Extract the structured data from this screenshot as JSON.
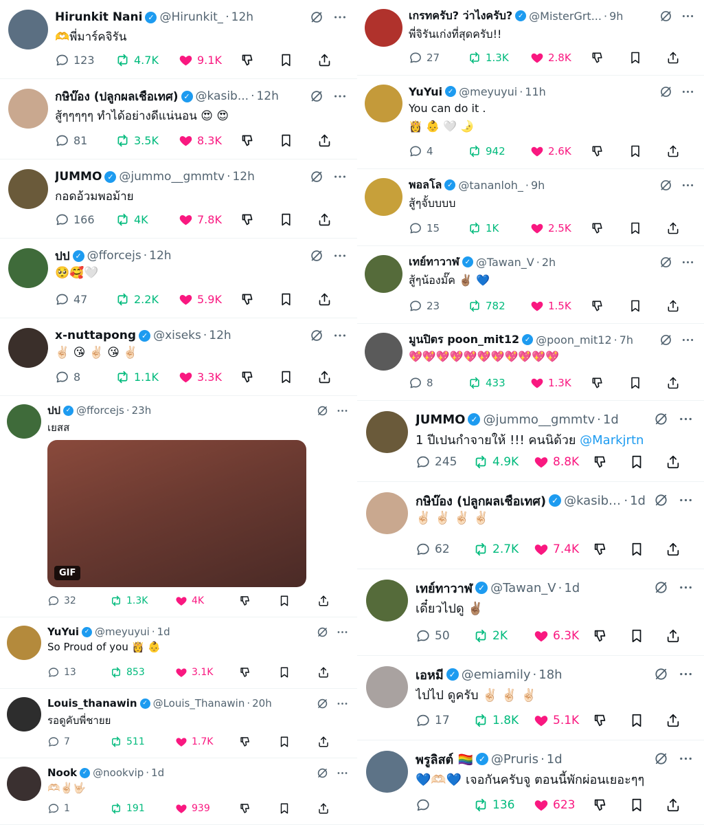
{
  "colors": {
    "accent": "#1d9bf0",
    "retweet": "#00ba7c",
    "like": "#f91880",
    "muted": "#536471"
  },
  "left_tweets": [
    {
      "name": "Hirunkit Nani",
      "handle": "@Hirunkit_",
      "time": "12h",
      "text": "🫶พี่มาร์คจิรัน",
      "replies": "123",
      "reposts": "4.7K",
      "likes": "9.1K"
    },
    {
      "name": "กษิบ๊อง (ปลูกผลเชือเทศ)",
      "handle": "@kasib...",
      "time": "12h",
      "text": "สู้ๆๆๆๆๆ ทำได้อย่างดีแน่นอน 😍 😍",
      "replies": "81",
      "reposts": "3.5K",
      "likes": "8.3K"
    },
    {
      "name": "JUMMO",
      "handle": "@jummo__gmmtv",
      "time": "12h",
      "text": "กอดอ้วมพอม้าย",
      "replies": "166",
      "reposts": "4K",
      "likes": "7.8K"
    },
    {
      "name": "ปป",
      "handle": "@fforcejs",
      "time": "12h",
      "text": "🥺🥰🤍",
      "replies": "47",
      "reposts": "2.2K",
      "likes": "5.9K"
    },
    {
      "name": "x-nuttapong",
      "handle": "@xiseks",
      "time": "12h",
      "text": "✌🏻 😘 ✌🏻 😘 ✌🏻",
      "replies": "8",
      "reposts": "1.1K",
      "likes": "3.3K"
    },
    {
      "name": "ปป",
      "handle": "@fforcejs",
      "time": "23h",
      "text": "เยสส",
      "gif_label": "GIF",
      "replies": "32",
      "reposts": "1.3K",
      "likes": "4K"
    },
    {
      "name": "YuYui",
      "handle": "@meyuyui",
      "time": "1d",
      "text": "So Proud of you 👸 👶",
      "replies": "13",
      "reposts": "853",
      "likes": "3.1K"
    },
    {
      "name": "Louis_thanawin",
      "handle": "@Louis_Thanawin",
      "time": "20h",
      "text": "รอดูคับพี่ชายย",
      "replies": "7",
      "reposts": "511",
      "likes": "1.7K"
    },
    {
      "name": "Nook",
      "handle": "@nookvip",
      "time": "1d",
      "text": "🫶🏻✌🏻🤟🏻",
      "replies": "1",
      "reposts": "191",
      "likes": "939"
    }
  ],
  "right_tweets": [
    {
      "name": "เกรทครับ? ว่าไงครับ?",
      "handle": "@MisterGrt...",
      "time": "9h",
      "text": "พี่จิรันเก่งที่สุดครับ!!",
      "replies": "27",
      "reposts": "1.3K",
      "likes": "2.8K"
    },
    {
      "name": "YuYui",
      "handle": "@meyuyui",
      "time": "11h",
      "text": "You can do it .",
      "text2": "👸 👶 🤍 🌛",
      "replies": "4",
      "reposts": "942",
      "likes": "2.6K"
    },
    {
      "name": "พอลโล",
      "handle": "@tananloh_",
      "time": "9h",
      "text": "สู้ๆจั้บบบบ",
      "replies": "15",
      "reposts": "1K",
      "likes": "2.5K"
    },
    {
      "name": "เทย์ทาวาฬ",
      "handle": "@Tawan_V",
      "time": "2h",
      "text": "สู้ๆน้องมั๊ค ✌🏽 💙",
      "replies": "23",
      "reposts": "782",
      "likes": "1.5K"
    },
    {
      "name": "มูนปิตร poon_mit12",
      "handle": "@poon_mit12",
      "time": "7h",
      "text": "💖💖💖💖💖💖💖💖💖💖💖",
      "replies": "8",
      "reposts": "433",
      "likes": "1.3K"
    },
    {
      "name": "JUMMO",
      "handle": "@jummo__gmmtv",
      "time": "1d",
      "text": "1 ปีเปนกำจายให้ !!! คนนิด้วย ",
      "mention": "@Markjrtn",
      "replies": "245",
      "reposts": "4.9K",
      "likes": "8.8K"
    },
    {
      "name": "กษิบ๊อง (ปลูกผลเชือเทศ)",
      "handle": "@kasibook",
      "time": "1d",
      "text": "✌🏻 ✌🏻 ✌🏻 ✌🏻",
      "replies": "62",
      "reposts": "2.7K",
      "likes": "7.4K"
    },
    {
      "name": "เทย์ทาวาฬ",
      "handle": "@Tawan_V",
      "time": "1d",
      "text": "เดี๋ยวไปดู ✌🏽",
      "replies": "50",
      "reposts": "2K",
      "likes": "6.3K"
    },
    {
      "name": "เอหมี",
      "handle": "@emiamily",
      "time": "18h",
      "text": "ไปไป ดูครับ ✌🏻 ✌🏻 ✌🏻",
      "replies": "17",
      "reposts": "1.8K",
      "likes": "5.1K"
    },
    {
      "name": "พรูลิสต์ 🏳️‍🌈",
      "handle": "@Pruris",
      "time": "1d",
      "text": "💙🫶🏻💙 เจอกันครับจู ตอนนี้พักผ่อนเยอะๆๆ",
      "replies": "",
      "reposts": "136",
      "likes": "623"
    }
  ]
}
